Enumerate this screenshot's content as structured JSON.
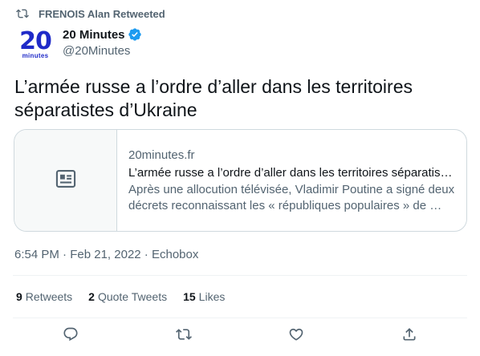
{
  "retweet_banner": {
    "text": "FRENOIS Alan Retweeted",
    "icon": "retweet-icon"
  },
  "author": {
    "avatar_text_number": "20",
    "avatar_text_word": "minutes",
    "display_name": "20 Minutes",
    "verified": true,
    "handle": "@20Minutes"
  },
  "tweet": {
    "text": "L’armée russe a l’ordre d’aller dans les territoires séparatistes d’Ukraine"
  },
  "link_card": {
    "icon": "article-icon",
    "domain": "20minutes.fr",
    "title": "L’armée russe a l’ordre d’aller dans les territoires séparatistes d’Ukraine",
    "description": "Après une allocution télévisée, Vladimir Poutine a signé deux décrets reconnaissant les « républiques populaires » de …"
  },
  "meta": {
    "time": "6:54 PM",
    "separator": " · ",
    "date": "Feb 21, 2022",
    "source": "Echobox"
  },
  "stats": {
    "retweets_count": "9",
    "retweets_label": "Retweets",
    "quotes_count": "2",
    "quotes_label": "Quote Tweets",
    "likes_count": "15",
    "likes_label": "Likes"
  },
  "actions": [
    "reply-icon",
    "retweet-icon",
    "like-icon",
    "share-icon"
  ],
  "colors": {
    "text_primary": "#0f1419",
    "text_secondary": "#536471",
    "border": "#cfd9de",
    "brand_blue": "#1f2ac8",
    "verified_blue": "#1d9bf0"
  }
}
